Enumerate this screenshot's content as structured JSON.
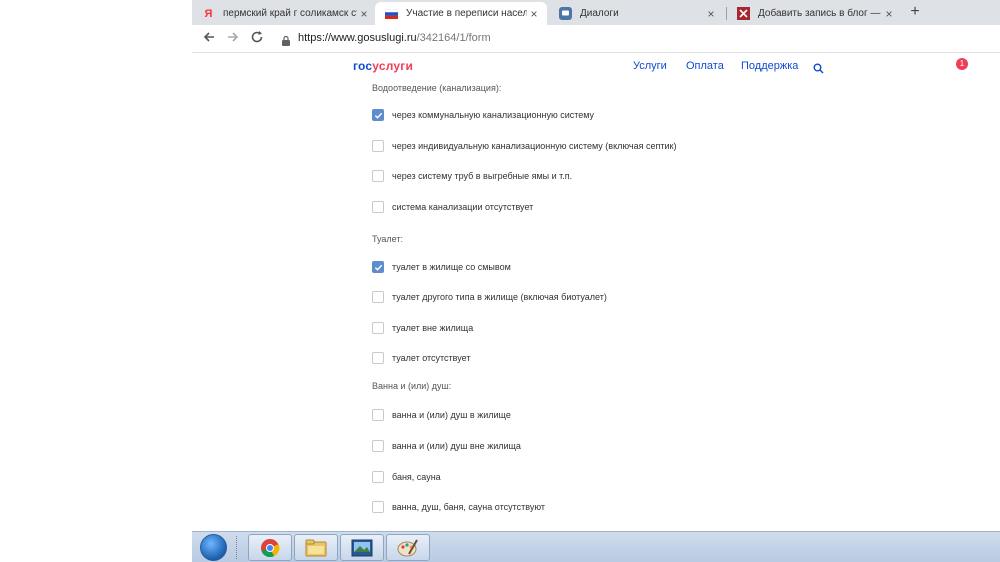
{
  "browser": {
    "tabs": [
      {
        "title": "пермский край г соликамск ст.р",
        "favicon": "yandex-icon",
        "active": false
      },
      {
        "title": "Участие в переписи населения",
        "favicon": "russia-flag-icon",
        "active": true
      },
      {
        "title": "Диалоги",
        "favicon": "vk-chat-icon",
        "active": false
      },
      {
        "title": "Добавить запись в блог — Vsol",
        "favicon": "blog-icon",
        "active": false
      }
    ],
    "close_glyph": "×",
    "new_tab_glyph": "+",
    "url_host": "https://www.gosuslugi.ru",
    "url_path": "/342164/1/form"
  },
  "site": {
    "logo_gos": "гос",
    "logo_uslugi": "услуги",
    "nav": [
      "Услуги",
      "Оплата",
      "Поддержка"
    ],
    "notification_count": "1",
    "brand_blue": "#0d4cd3",
    "brand_red": "#ee3f58"
  },
  "form": {
    "sections": [
      {
        "title": "Водоотведение (канализация):",
        "options": [
          {
            "label": "через коммунальную канализационную систему",
            "checked": true
          },
          {
            "label": "через индивидуальную канализационную систему (включая септик)",
            "checked": false
          },
          {
            "label": "через систему труб в выгребные ямы и т.п.",
            "checked": false
          },
          {
            "label": "система канализации отсутствует",
            "checked": false
          }
        ]
      },
      {
        "title": "Туалет:",
        "options": [
          {
            "label": "туалет в жилище со смывом",
            "checked": true
          },
          {
            "label": "туалет другого типа в жилище (включая биотуалет)",
            "checked": false
          },
          {
            "label": "туалет вне жилища",
            "checked": false
          },
          {
            "label": "туалет отсутствует",
            "checked": false
          }
        ]
      },
      {
        "title": "Ванна и (или) душ:",
        "options": [
          {
            "label": "ванна и (или) душ в жилище",
            "checked": false
          },
          {
            "label": "ванна и (или) душ вне жилища",
            "checked": false
          },
          {
            "label": "баня, сауна",
            "checked": false
          },
          {
            "label": "ванна, душ, баня, сауна отсутствуют",
            "checked": false
          }
        ]
      }
    ]
  },
  "taskbar": {
    "items": [
      "chrome-icon",
      "file-explorer-icon",
      "image-viewer-icon",
      "paint-icon"
    ]
  }
}
